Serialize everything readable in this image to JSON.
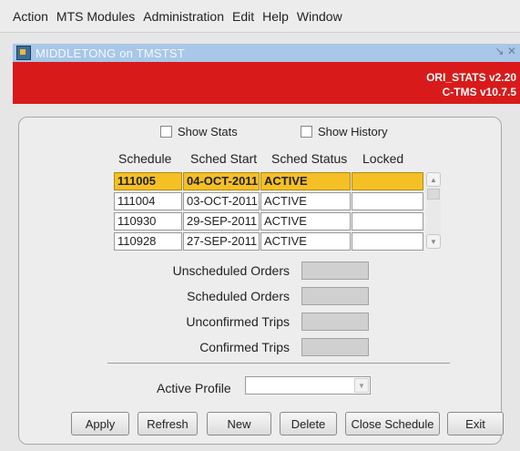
{
  "menu": [
    {
      "label": "Action"
    },
    {
      "label": "MTS Modules"
    },
    {
      "label": "Administration"
    },
    {
      "label": "Edit"
    },
    {
      "label": "Help"
    },
    {
      "label": "Window"
    }
  ],
  "window": {
    "title": "MIDDLETONG on TMSTST",
    "controls": "↘ ✕"
  },
  "header": {
    "version1": "ORI_STATS v2.20",
    "version2": "C-TMS v10.7.5"
  },
  "checkboxes": {
    "show_stats": "Show Stats",
    "show_history": "Show History"
  },
  "table": {
    "columns": [
      "Schedule",
      "Sched Start",
      "Sched Status",
      "Locked"
    ],
    "rows": [
      {
        "schedule": "111005",
        "start": "04-OCT-2011",
        "status": "ACTIVE",
        "locked": ""
      },
      {
        "schedule": "111004",
        "start": "03-OCT-2011",
        "status": "ACTIVE",
        "locked": ""
      },
      {
        "schedule": "110930",
        "start": "29-SEP-2011",
        "status": "ACTIVE",
        "locked": ""
      },
      {
        "schedule": "110928",
        "start": "27-SEP-2011",
        "status": "ACTIVE",
        "locked": ""
      }
    ]
  },
  "stats": {
    "unscheduled_orders": "Unscheduled Orders",
    "scheduled_orders": "Scheduled Orders",
    "unconfirmed_trips": "Unconfirmed Trips",
    "confirmed_trips": "Confirmed Trips"
  },
  "profile": {
    "label": "Active Profile",
    "value": ""
  },
  "buttons": {
    "apply": "Apply",
    "refresh": "Refresh",
    "new": "New",
    "delete": "Delete",
    "close_schedule": "Close Schedule",
    "exit": "Exit"
  },
  "icons": {
    "scroll_up": "▲",
    "scroll_down": "▼",
    "dropdown": "▼"
  },
  "colors": {
    "selected_row": "#f5c026",
    "banner": "#d91a1a",
    "titlebar": "#a9c7e8"
  }
}
